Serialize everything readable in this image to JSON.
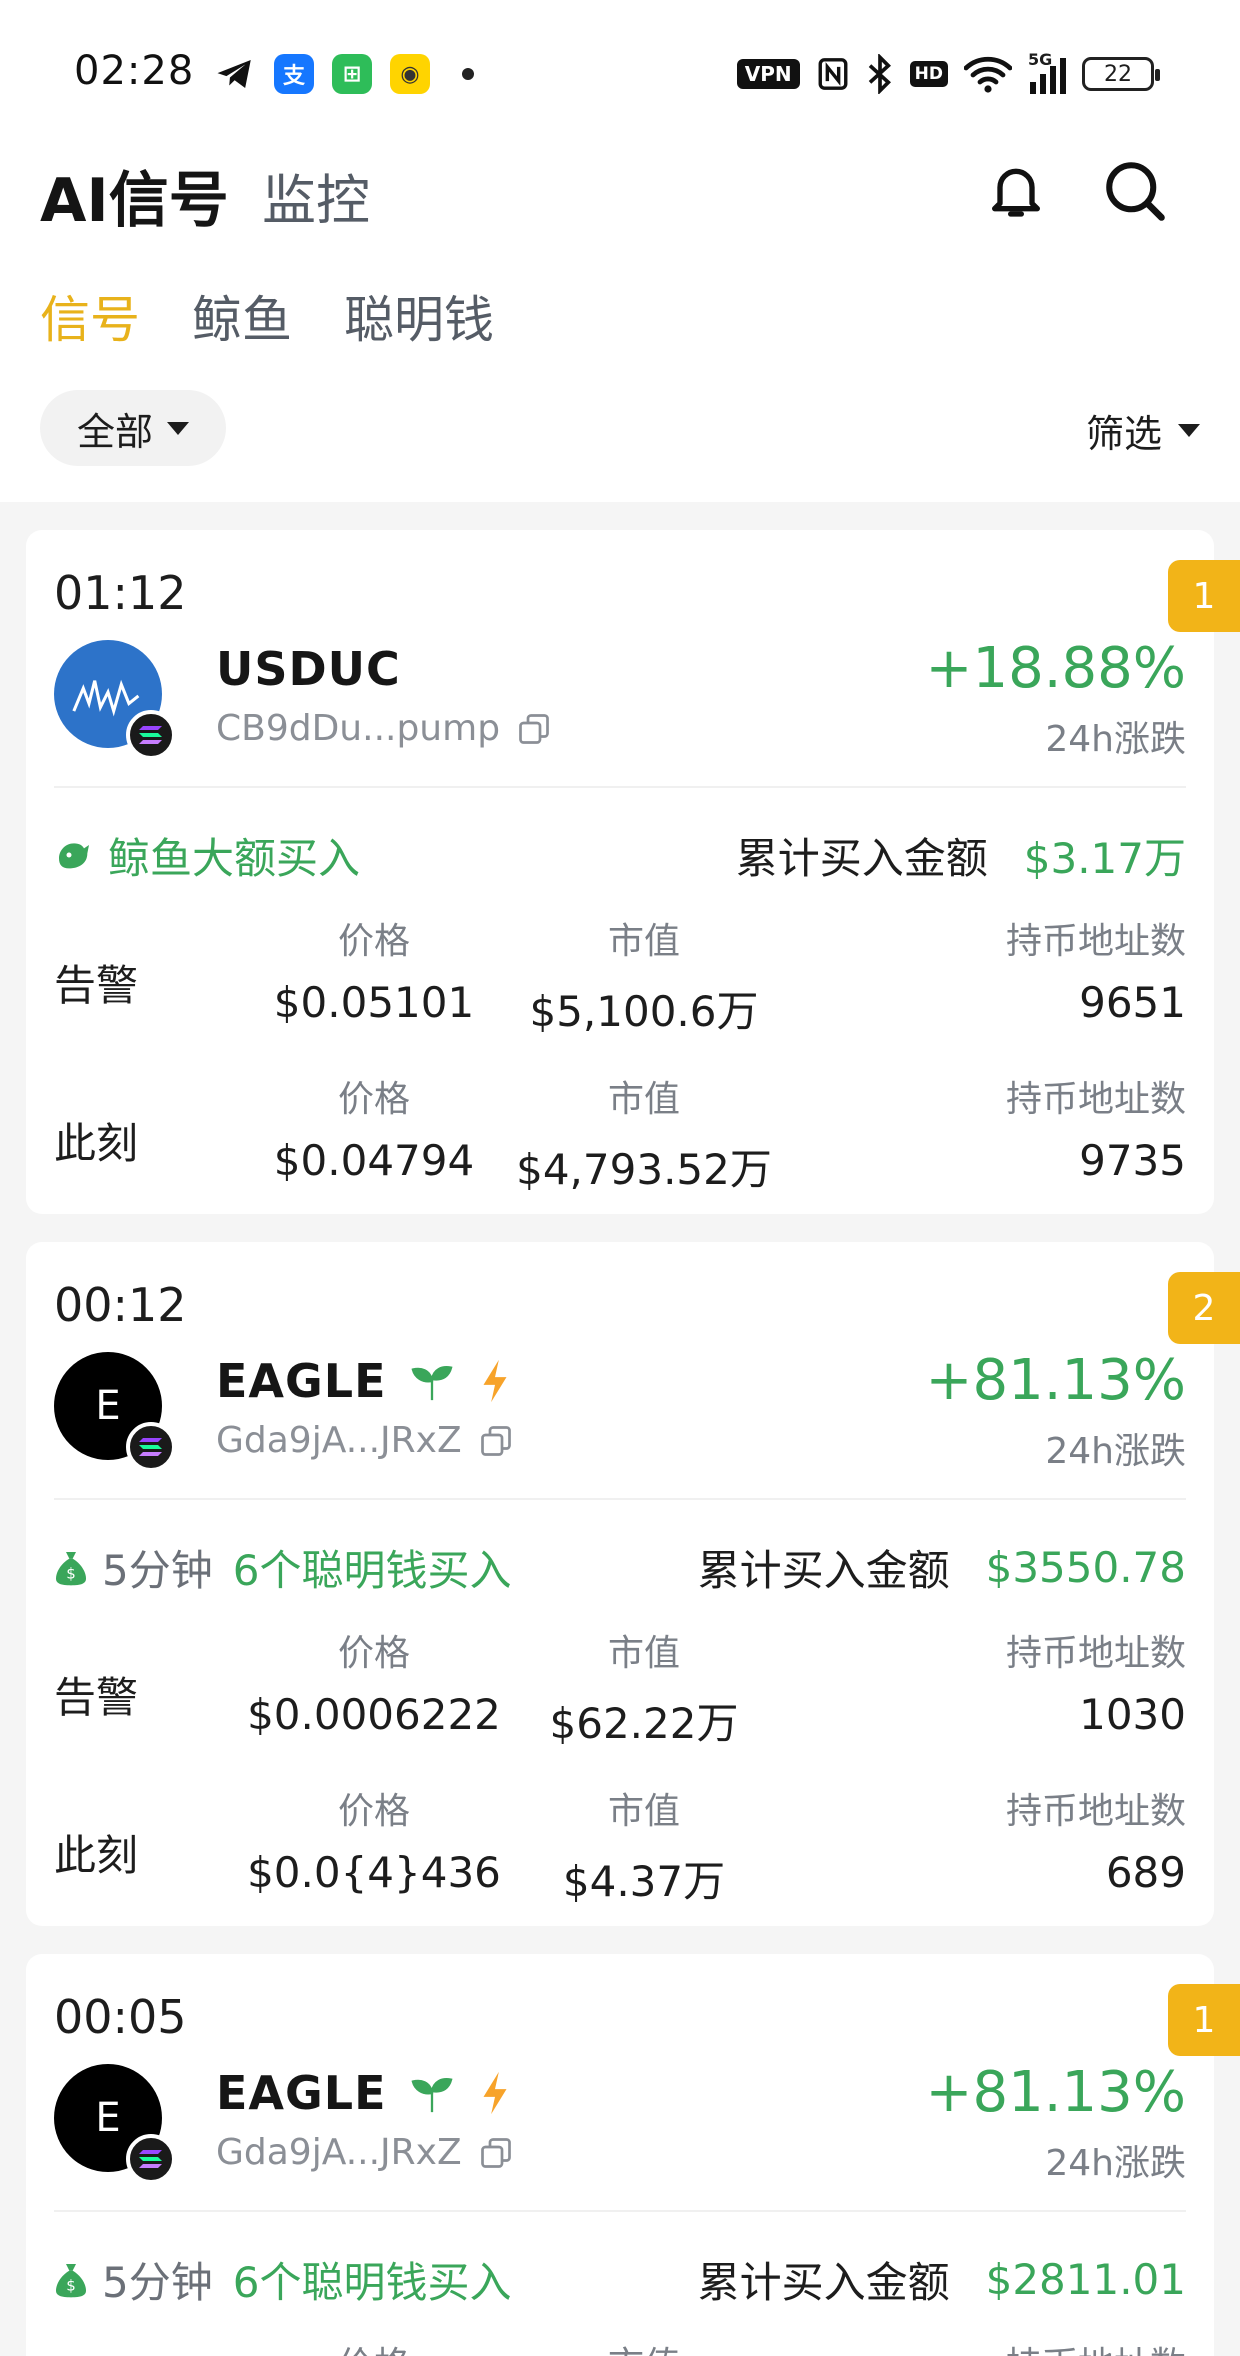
{
  "status_bar": {
    "time": "02:28",
    "vpn": "VPN",
    "hd": "HD",
    "network": "5G",
    "battery": "22"
  },
  "header": {
    "title": "AI信号",
    "subtitle": "监控"
  },
  "tabs": [
    {
      "label": "信号",
      "active": true
    },
    {
      "label": "鲸鱼",
      "active": false
    },
    {
      "label": "聪明钱",
      "active": false
    }
  ],
  "filters": {
    "all_label": "全部",
    "filter_label": "筛选"
  },
  "labels": {
    "change_24h": "24h涨跌",
    "cumulative_buy": "累计买入金额",
    "alert_row": "告警",
    "now_row": "此刻",
    "price": "价格",
    "market_cap": "市值",
    "holders": "持币地址数"
  },
  "cards": [
    {
      "rank": "1",
      "time": "01:12",
      "token": "USDUC",
      "address": "CB9dDu...pump",
      "change": "+18.88%",
      "signal_icon": "whale-icon",
      "signal_prefix": "",
      "signal_text": "鲸鱼大额买入",
      "buy_amount": "$3.17万",
      "alert": {
        "price": "$0.05101",
        "market_cap": "$5,100.6万",
        "holders": "9651"
      },
      "now": {
        "price": "$0.04794",
        "market_cap": "$4,793.52万",
        "holders": "9735"
      },
      "avatar_text": "",
      "avatar_color": "#2d73c9"
    },
    {
      "rank": "2",
      "time": "00:12",
      "token": "EAGLE",
      "address": "Gda9jA...JRxZ",
      "change": "+81.13%",
      "signal_icon": "money-bag-icon",
      "signal_prefix": "5分钟",
      "signal_text": "6个聪明钱买入",
      "buy_amount": "$3550.78",
      "alert": {
        "price": "$0.0006222",
        "market_cap": "$62.22万",
        "holders": "1030"
      },
      "now": {
        "price": "$0.0{4}436",
        "market_cap": "$4.37万",
        "holders": "689"
      },
      "avatar_text": "E",
      "avatar_color": "#000000"
    },
    {
      "rank": "1",
      "time": "00:05",
      "token": "EAGLE",
      "address": "Gda9jA...JRxZ",
      "change": "+81.13%",
      "signal_icon": "money-bag-icon",
      "signal_prefix": "5分钟",
      "signal_text": "6个聪明钱买入",
      "buy_amount": "$2811.01",
      "avatar_text": "E",
      "avatar_color": "#000000"
    }
  ],
  "colors": {
    "accent": "#e8b21b",
    "badge": "#f2b418",
    "positive": "#3aa65a",
    "negative": "#d6455b"
  }
}
